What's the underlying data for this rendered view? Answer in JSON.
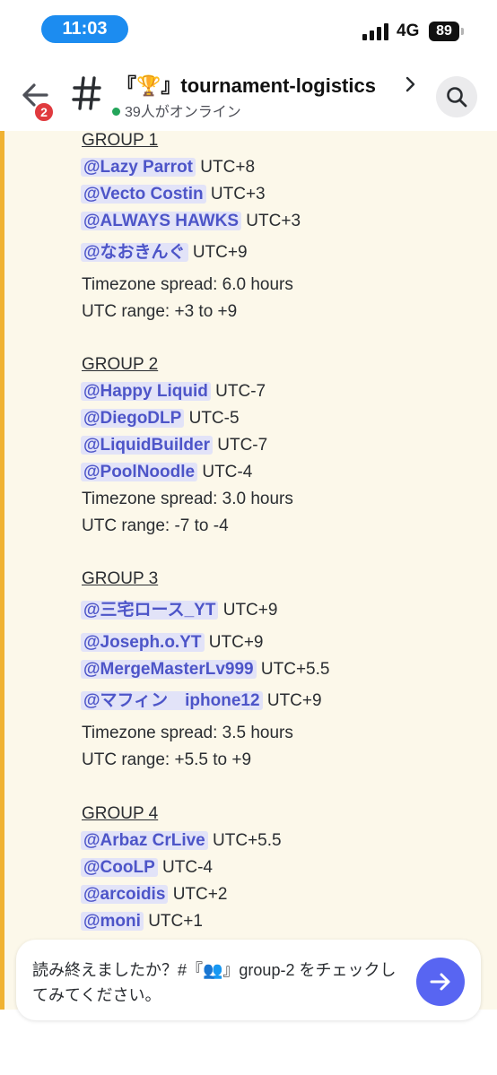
{
  "status_bar": {
    "time": "11:03",
    "network": "4G",
    "battery": "89"
  },
  "header": {
    "unread_count": "2",
    "channel_name": "『🏆』tournament-logistics",
    "online_text": "39人がオンライン"
  },
  "groups": [
    {
      "title": "GROUP 1",
      "members": [
        {
          "mention": "@Lazy Parrot",
          "tz": "UTC+8"
        },
        {
          "mention": "@Vecto Costin",
          "tz": "UTC+3"
        },
        {
          "mention": "@ALWAYS HAWKS",
          "tz": "UTC+3"
        },
        {
          "mention": "@なおきんぐ",
          "tz": "UTC+9"
        }
      ],
      "spread": "Timezone spread: 6.0 hours",
      "range": "UTC range: +3 to +9"
    },
    {
      "title": "GROUP 2",
      "members": [
        {
          "mention": "@Happy Liquid",
          "tz": "UTC-7"
        },
        {
          "mention": "@DiegoDLP",
          "tz": "UTC-5"
        },
        {
          "mention": "@LiquidBuilder",
          "tz": "UTC-7"
        },
        {
          "mention": "@PoolNoodle",
          "tz": "UTC-4"
        }
      ],
      "spread": "Timezone spread: 3.0 hours",
      "range": "UTC range: -7 to -4"
    },
    {
      "title": "GROUP 3",
      "members": [
        {
          "mention": "@三宅ロース_YT",
          "tz": "UTC+9"
        },
        {
          "mention": "@Joseph.o.YT",
          "tz": "UTC+9"
        },
        {
          "mention": "@MergeMasterLv999",
          "tz": "UTC+5.5"
        },
        {
          "mention": "@マフィン　iphone12",
          "tz": "UTC+9"
        }
      ],
      "spread": "Timezone spread: 3.5 hours",
      "range": "UTC range: +5.5 to +9"
    },
    {
      "title": "GROUP 4",
      "members": [
        {
          "mention": "@Arbaz CrLive",
          "tz": "UTC+5.5"
        },
        {
          "mention": "@CooLP",
          "tz": "UTC-4"
        },
        {
          "mention": "@arcoidis",
          "tz": "UTC+2"
        },
        {
          "mention": "@moni",
          "tz": "UTC+1"
        }
      ]
    }
  ],
  "composer": {
    "prompt": "読み終えましたか？#『👥』group-2 をチェックしてみてください。"
  },
  "colors": {
    "accent": "#5865f2",
    "mention_bg": "#e2e3f8",
    "mention_text": "#4d55c8",
    "highlight_bar": "#f0b232",
    "message_bg": "#fcf8ea",
    "badge": "#e03a3e",
    "online": "#23a55a",
    "time_pill": "#1c8cf0"
  },
  "icons": [
    "back-arrow-icon",
    "hash-icon",
    "chevron-right-icon",
    "search-icon",
    "send-arrow-icon",
    "signal-icon",
    "battery-icon"
  ]
}
